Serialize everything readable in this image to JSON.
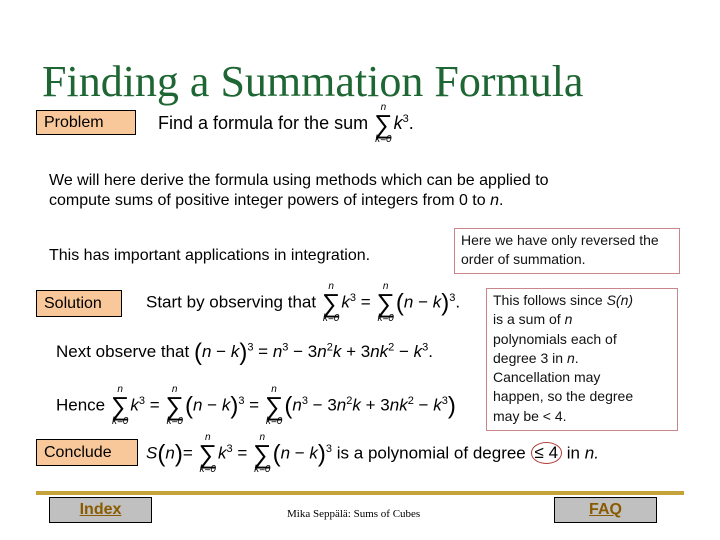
{
  "title": "Finding a Summation Formula",
  "problem": {
    "label": "Problem",
    "text": "Find a formula for the sum",
    "sum_upper": "n",
    "sum_lower": "k=0",
    "summand": "k",
    "exponent": "3",
    "end": "."
  },
  "intro": {
    "line1": "We will here derive the formula using methods which can be applied to",
    "line2_prefix": "compute sums of positive integer powers of integers from 0 to ",
    "line2_var": "n",
    "line2_end": "."
  },
  "applications": "This has important applications in integration.",
  "note_reversed": "Here we have only reversed the order of summation.",
  "solution": {
    "label": "Solution",
    "text": "Start by observing that",
    "next_text": "Next observe that",
    "hence_text": "Hence"
  },
  "note_degree": {
    "line1_prefix": "This follows since ",
    "line1_var": "S(n)",
    "line2_prefix": "is a sum of ",
    "line2_var": "n",
    "line3": "polynomials each of",
    "line4_prefix": "degree 3 in ",
    "line4_var": "n",
    "line4_end": ".",
    "line5": "Cancellation may",
    "line6": "happen, so the degree",
    "line7": "may be < 4."
  },
  "conclude": {
    "label": "Conclude",
    "text": "is a polynomial of degree",
    "degree": "≤ 4",
    "in_text": "in",
    "var": "n."
  },
  "footer": {
    "index_label": "Index",
    "faq_label": "FAQ",
    "credit": "Mika Seppälä: Sums of Cubes"
  },
  "colors": {
    "title": "#1e6633",
    "label_bg": "#f8c89a",
    "note_border": "#c9878b",
    "rule": "#c4a43a",
    "nav_bg": "#c0c0c0",
    "nav_text": "#8a5a00"
  }
}
